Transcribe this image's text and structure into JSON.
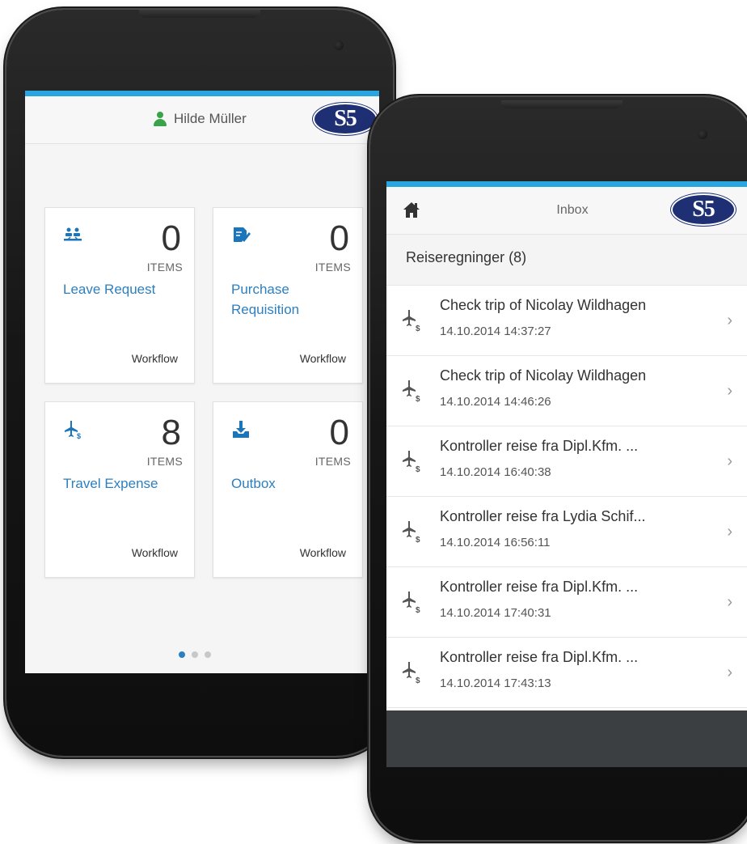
{
  "phone1": {
    "user_name": "Hilde Müller",
    "logo_text": "S5",
    "tiles": [
      {
        "count": "0",
        "unit": "ITEMS",
        "title": "Leave Request",
        "footer": "Workflow",
        "icon": "leave-request-icon"
      },
      {
        "count": "0",
        "unit": "ITEMS",
        "title": "Purchase Requisition",
        "footer": "Workflow",
        "icon": "purchase-requisition-icon"
      },
      {
        "count": "8",
        "unit": "ITEMS",
        "title": "Travel Expense",
        "footer": "Workflow",
        "icon": "travel-expense-icon"
      },
      {
        "count": "0",
        "unit": "ITEMS",
        "title": "Outbox",
        "footer": "Workflow",
        "icon": "outbox-icon"
      }
    ],
    "pagination": {
      "total": 3,
      "active": 1
    }
  },
  "phone2": {
    "title": "Inbox",
    "logo_text": "S5",
    "section_label": "Reiseregninger (8)",
    "items": [
      {
        "title": "Check trip of Nicolay Wildhagen",
        "date": "14.10.2014 14:37:27"
      },
      {
        "title": "Check trip of Nicolay Wildhagen",
        "date": "14.10.2014 14:46:26"
      },
      {
        "title": "Kontroller reise fra Dipl.Kfm. ...",
        "date": "14.10.2014 16:40:38"
      },
      {
        "title": "Kontroller reise fra Lydia Schif...",
        "date": "14.10.2014 16:56:11"
      },
      {
        "title": "Kontroller reise fra Dipl.Kfm. ...",
        "date": "14.10.2014 17:40:31"
      },
      {
        "title": "Kontroller reise fra Dipl.Kfm. ...",
        "date": "14.10.2014 17:43:13"
      }
    ]
  },
  "colors": {
    "accent": "#29a6e0",
    "link": "#2c7fc0",
    "logo": "#1e2f74",
    "user_icon": "#3aa34a"
  }
}
